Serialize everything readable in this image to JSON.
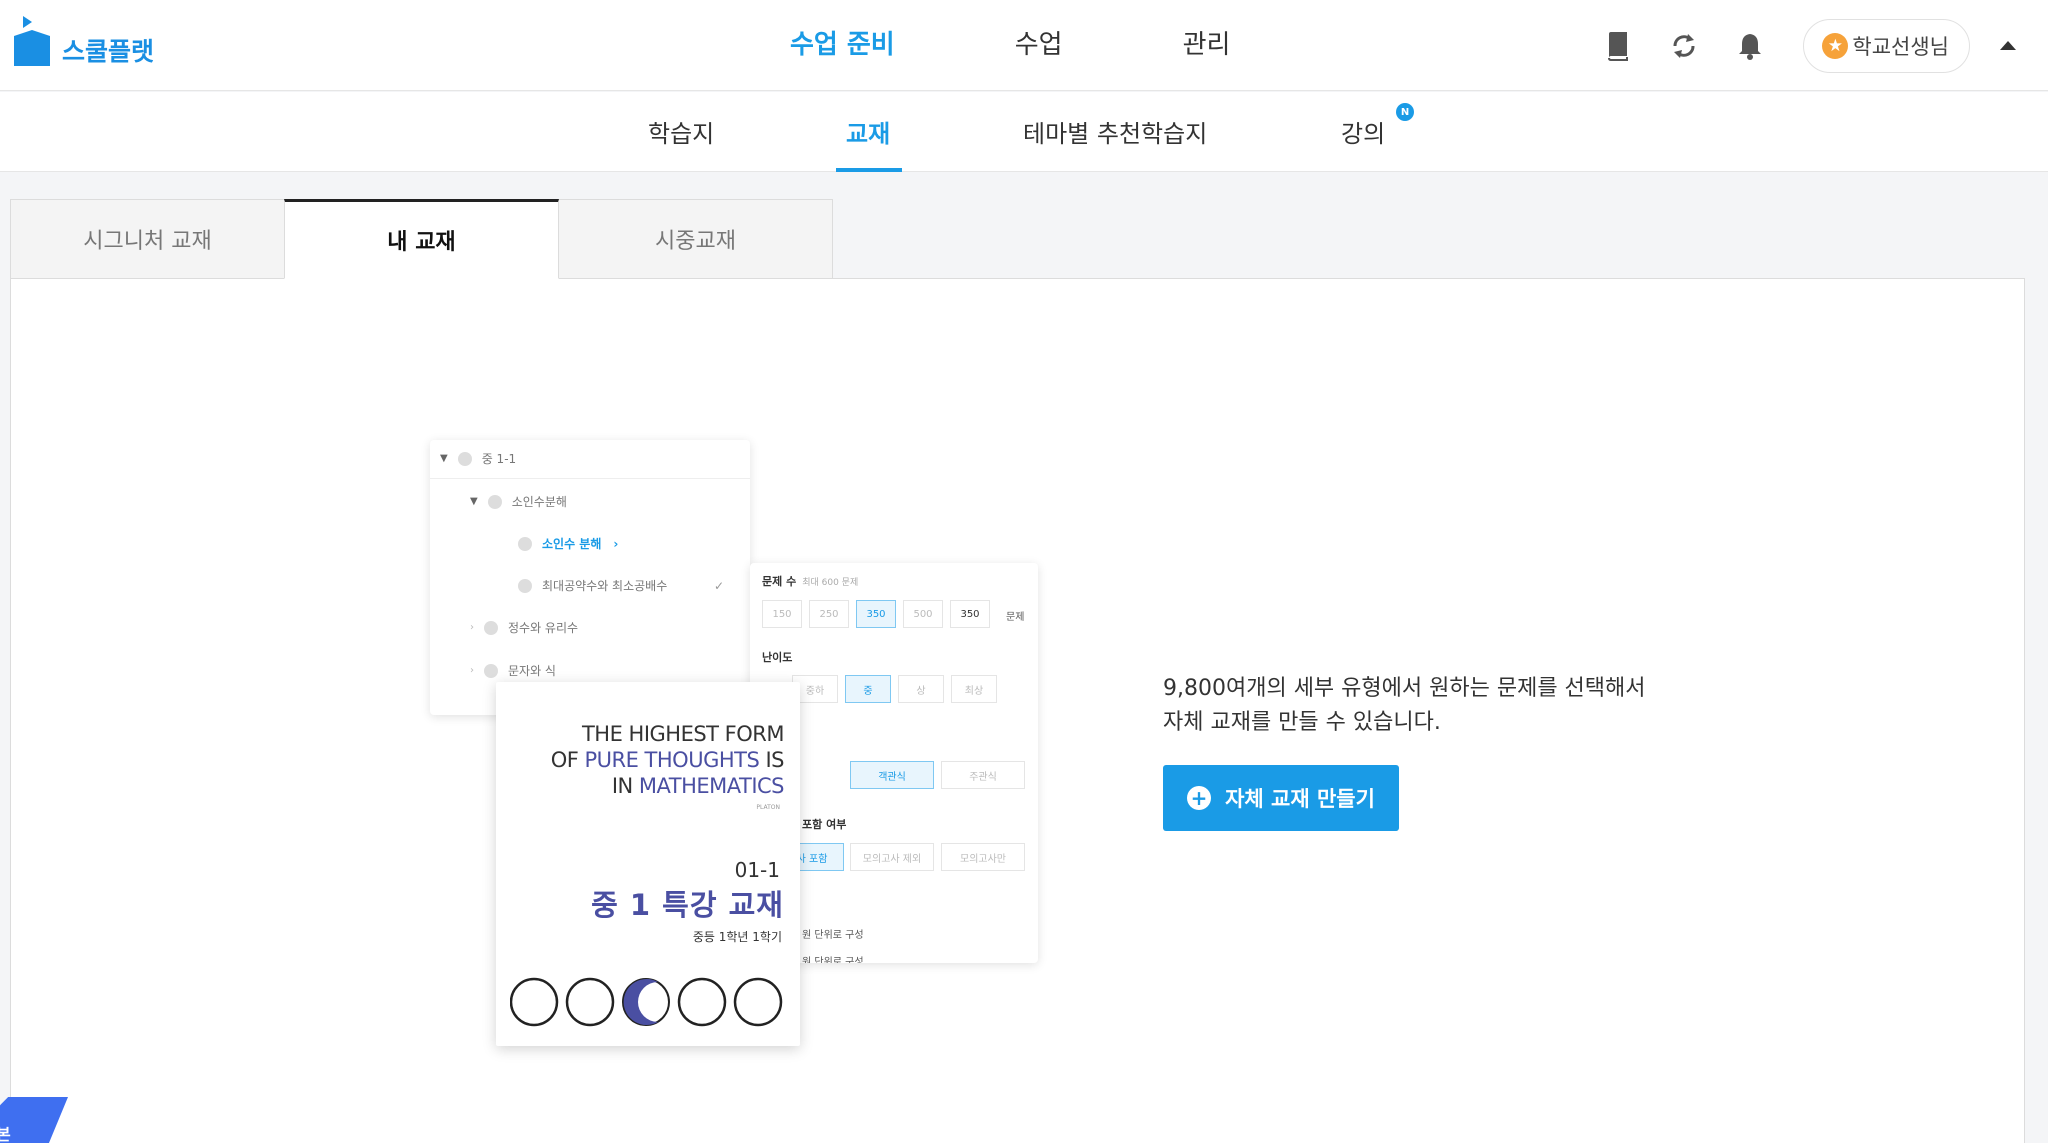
{
  "header": {
    "logo_text": "스쿨플랫",
    "nav": [
      {
        "label": "수업 준비",
        "active": true
      },
      {
        "label": "수업",
        "active": false
      },
      {
        "label": "관리",
        "active": false
      }
    ],
    "icons": [
      "book-icon",
      "refresh-icon",
      "bell-icon"
    ],
    "profile_name": "학교선생님",
    "profile_star": "★"
  },
  "subnav": {
    "items": [
      {
        "label": "학습지",
        "active": false
      },
      {
        "label": "교재",
        "active": true
      },
      {
        "label": "테마별 추천학습지",
        "active": false
      },
      {
        "label": "강의",
        "active": false
      }
    ],
    "badge": "N"
  },
  "tabs": [
    {
      "label": "시그니처 교재",
      "active": false
    },
    {
      "label": "내 교재",
      "active": true
    },
    {
      "label": "시중교재",
      "active": false
    }
  ],
  "illustration": {
    "tree": {
      "root": "중 1-1",
      "chapter": "소인수분해",
      "selected": "소인수 분해",
      "item2": "최대공약수와 최소공배수",
      "item3": "정수와 유리수",
      "item4": "문자와 식"
    },
    "settings": {
      "count_label": "문제 수",
      "count_sub": "최대 600 문제",
      "count_options": [
        "150",
        "250",
        "350",
        "500"
      ],
      "count_value": "350",
      "count_unit": "문제",
      "difficulty_label": "난이도",
      "difficulty_options": [
        "중하",
        "중",
        "상",
        "최상"
      ],
      "type_options": [
        "객관식",
        "주관식"
      ],
      "mock_label": "포함 여부",
      "mock_options": [
        "사 포함",
        "모의고사 제외",
        "모의고사만"
      ],
      "note1": "원 단위로 구성",
      "note2": "원 단위로 구성"
    },
    "book": {
      "line1": "THE HIGHEST FORM",
      "line2_pre": "OF ",
      "line2_em": "PURE THOUGHTS",
      "line2_post": " IS",
      "line3_pre": "IN ",
      "line3_em": "MATHEMATICS",
      "quote_author": "PLATON",
      "code": "01-1",
      "title": "중 1 특강 교재",
      "grade": "중등 1학년 1학기"
    }
  },
  "main": {
    "desc_line1": "9,800여개의 세부 유형에서 원하는 문제를 선택해서",
    "desc_line2": "자체 교재를 만들 수 있습니다.",
    "cta_label": "자체 교재 만들기",
    "cta_icon": "+"
  },
  "corner_text": "본",
  "colors": {
    "accent": "#1a9be6",
    "book_accent": "#4a4fa2",
    "corner": "#3f6ff0",
    "star": "#f6a23a"
  }
}
